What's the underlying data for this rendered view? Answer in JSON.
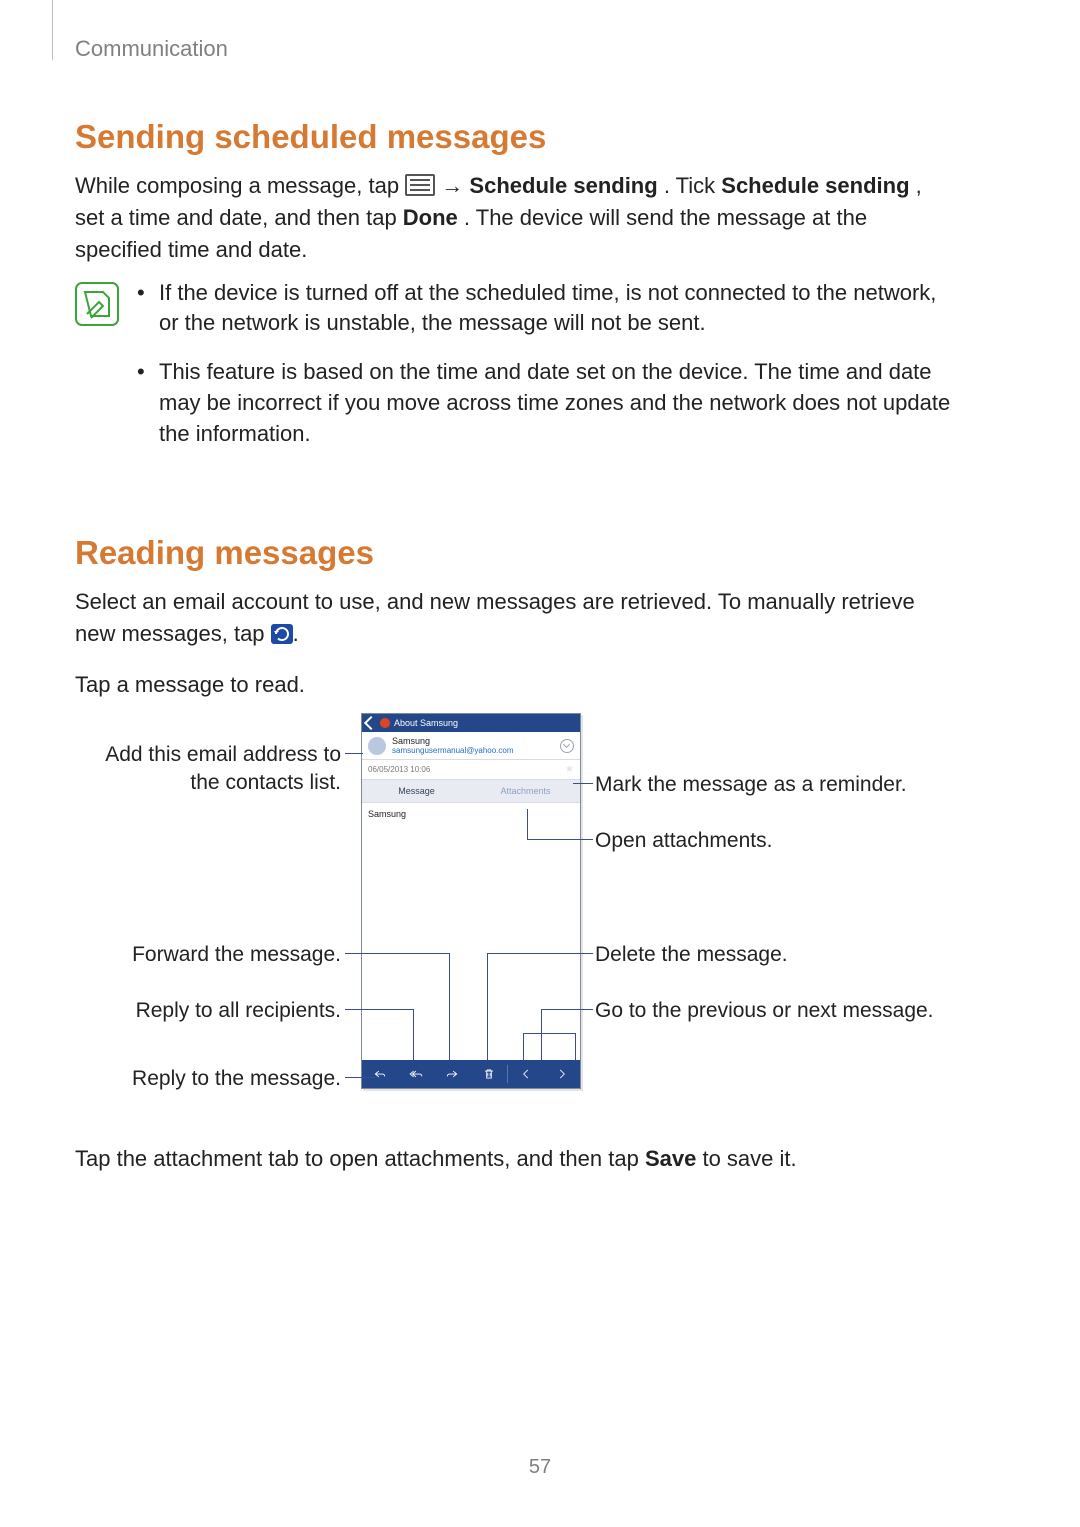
{
  "header": {
    "section": "Communication"
  },
  "section1": {
    "heading": "Sending scheduled messages",
    "p1_a": "While composing a message, tap ",
    "p1_b": " → ",
    "p1_c": "Schedule sending",
    "p1_d": ". Tick ",
    "p1_e": "Schedule sending",
    "p1_f": ", set a time and date, and then tap ",
    "p1_g": "Done",
    "p1_h": ". The device will send the message at the specified time and date.",
    "notes": [
      "If the device is turned off at the scheduled time, is not connected to the network, or the network is unstable, the message will not be sent.",
      "This feature is based on the time and date set on the device. The time and date may be incorrect if you move across time zones and the network does not update the information."
    ]
  },
  "section2": {
    "heading": "Reading messages",
    "p1_a": "Select an email account to use, and new messages are retrieved. To manually retrieve new messages, tap ",
    "p1_b": ".",
    "p2": "Tap a message to read.",
    "p3_a": "Tap the attachment tab to open attachments, and then tap ",
    "p3_b": "Save",
    "p3_c": " to save it."
  },
  "figure": {
    "header_title": "About Samsung",
    "sender_name": "Samsung",
    "sender_email": "samsungusermanual@yahoo.com",
    "date": "06/05/2013  10:06",
    "tab_message": "Message",
    "tab_attachments": "Attachments",
    "body_text": "Samsung",
    "callouts_left": {
      "add_contact": "Add this email address to the contacts list.",
      "forward": "Forward the message.",
      "reply_all": "Reply to all recipients.",
      "reply": "Reply to the message."
    },
    "callouts_right": {
      "reminder": "Mark the message as a reminder.",
      "attachments": "Open attachments.",
      "delete": "Delete the message.",
      "navigate": "Go to the previous or next message."
    }
  },
  "page_number": "57"
}
